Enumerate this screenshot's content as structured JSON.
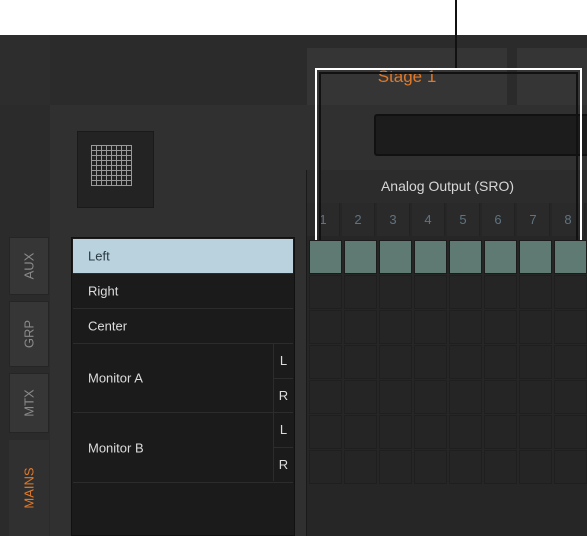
{
  "stage": {
    "tab_label": "Stage 1"
  },
  "side_tabs": [
    {
      "label": "AUX"
    },
    {
      "label": "GRP"
    },
    {
      "label": "MTX"
    },
    {
      "label": "MAINS"
    }
  ],
  "channels": {
    "left": "Left",
    "right": "Right",
    "center": "Center",
    "monitor_a": "Monitor A",
    "monitor_b": "Monitor B",
    "sub_l": "L",
    "sub_r": "R"
  },
  "matrix": {
    "title": "Analog Output (SRO)",
    "columns": [
      "1",
      "2",
      "3",
      "4",
      "5",
      "6",
      "7",
      "8"
    ],
    "active_row": "Left"
  },
  "colors": {
    "accent": "#e0792a",
    "selected_row": "#b9d2dd",
    "active_cell": "#5f7a73"
  }
}
